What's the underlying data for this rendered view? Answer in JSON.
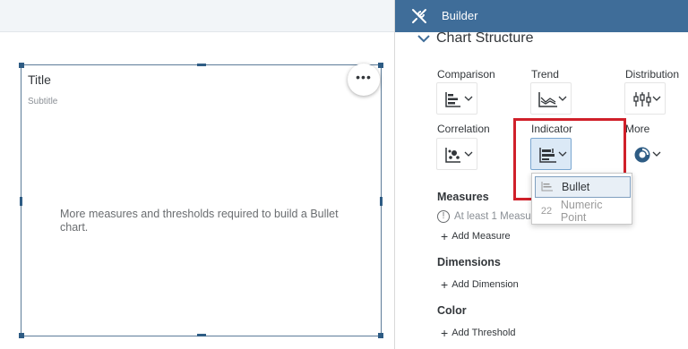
{
  "builder": {
    "header_title": "Builder",
    "section_title": "Chart Structure",
    "categories": {
      "comparison": "Comparison",
      "trend": "Trend",
      "distribution": "Distribution",
      "correlation": "Correlation",
      "indicator": "Indicator",
      "more": "More"
    },
    "indicator_menu": {
      "items": [
        {
          "label": "Bullet",
          "icon": "bullet-chart-icon"
        },
        {
          "label": "Numeric Point",
          "icon": "numeric-point-icon",
          "icon_glyph": "22"
        }
      ]
    },
    "measures": {
      "title": "Measures",
      "note": "At least 1 Measure",
      "add_label": "Add Measure"
    },
    "dimensions": {
      "title": "Dimensions",
      "add_label": "Add Dimension"
    },
    "color": {
      "title": "Color",
      "add_label": "Add Threshold"
    }
  },
  "widget": {
    "title": "Title",
    "subtitle": "Subtitle",
    "more_label": "•••",
    "message": "More measures and thresholds required to build a Bullet chart."
  },
  "colors": {
    "header_bg": "#3f6d99",
    "accent": "#2e5c84",
    "highlight": "#d0202a"
  }
}
